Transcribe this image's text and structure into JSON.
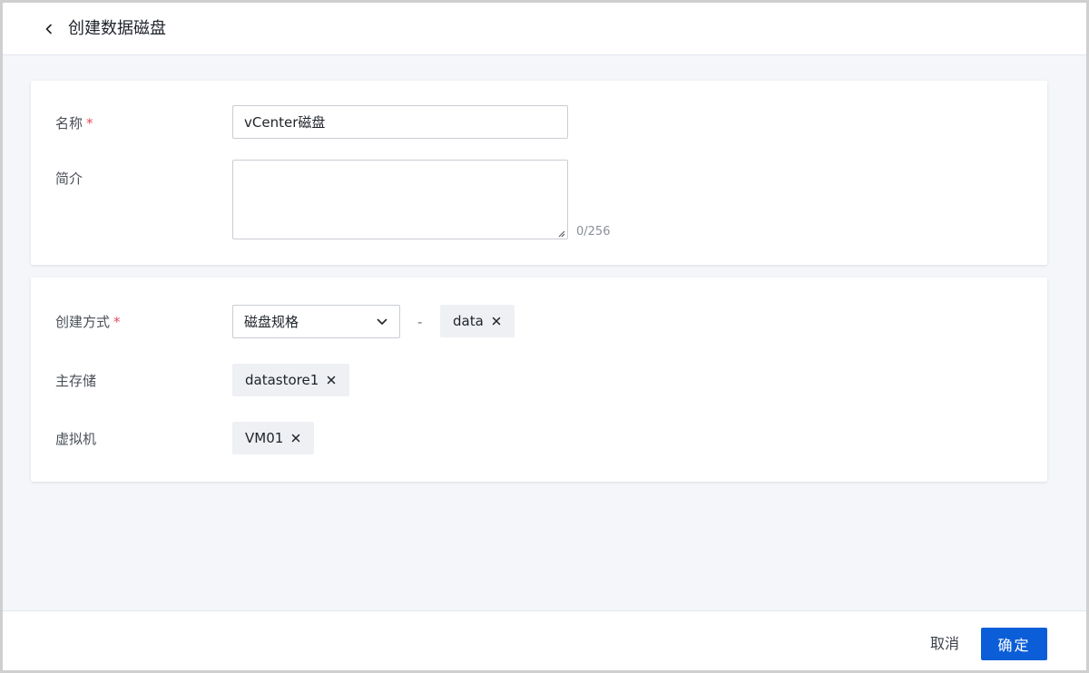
{
  "header": {
    "title": "创建数据磁盘"
  },
  "basic": {
    "name_label": "名称",
    "name_value": "vCenter磁盘",
    "desc_label": "简介",
    "desc_value": "",
    "desc_counter": "0/256",
    "required_mark": "*"
  },
  "config": {
    "method_label": "创建方式",
    "method_value": "磁盘规格",
    "separator": "-",
    "spec_tag": "data",
    "storage_label": "主存储",
    "storage_tag": "datastore1",
    "vm_label": "虚拟机",
    "vm_tag": "VM01",
    "required_mark": "*"
  },
  "footer": {
    "cancel_label": "取消",
    "confirm_label": "确定"
  },
  "colors": {
    "primary": "#0b5ed7",
    "required": "#e34d59",
    "tag_bg": "#eef0f4"
  },
  "icons": {
    "back": "chevron-left-icon",
    "select": "chevron-down-icon",
    "tag_remove": "close-icon"
  }
}
